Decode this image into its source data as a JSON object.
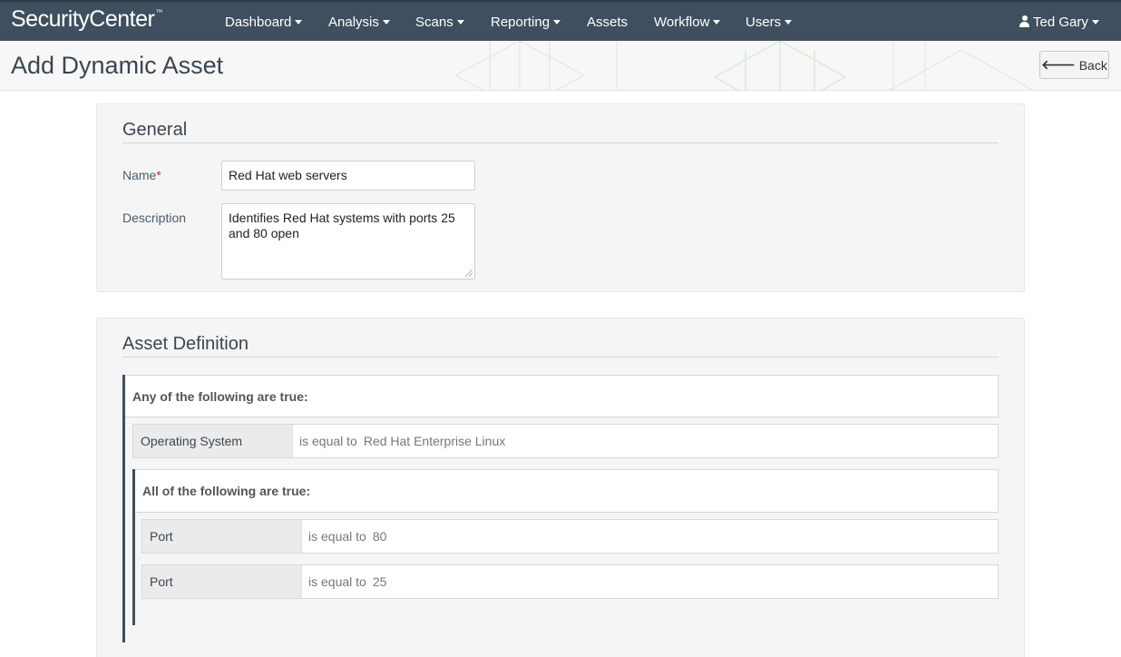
{
  "app": {
    "brand": "SecurityCenter",
    "brand_mark": "™"
  },
  "nav": {
    "items": [
      {
        "label": "Dashboard",
        "has_menu": true
      },
      {
        "label": "Analysis",
        "has_menu": true
      },
      {
        "label": "Scans",
        "has_menu": true
      },
      {
        "label": "Reporting",
        "has_menu": true
      },
      {
        "label": "Assets",
        "has_menu": false
      },
      {
        "label": "Workflow",
        "has_menu": true
      },
      {
        "label": "Users",
        "has_menu": true
      }
    ],
    "user": {
      "label": "Ted Gary",
      "icon": "user-icon"
    }
  },
  "header": {
    "title": "Add Dynamic Asset",
    "back_label": "Back",
    "back_icon": "arrow-left-icon"
  },
  "general": {
    "title": "General",
    "name_label": "Name",
    "required_mark": "*",
    "name_value": "Red Hat web servers",
    "description_label": "Description",
    "description_value": "Identifies Red Hat systems with ports 25 and 80 open"
  },
  "definition": {
    "title": "Asset Definition",
    "outer_group": {
      "label": "Any of the following are true:",
      "rules": [
        {
          "field": "Operating System",
          "operator": "is equal to",
          "value": "Red Hat Enterprise Linux"
        }
      ],
      "inner_group": {
        "label": "All of the following are true:",
        "rules": [
          {
            "field": "Port",
            "operator": "is equal to",
            "value": "80"
          },
          {
            "field": "Port",
            "operator": "is equal to",
            "value": "25"
          }
        ]
      }
    }
  },
  "colors": {
    "nav_bg": "#3f4f5f",
    "accent_border": "#3f4f5f",
    "required": "#c0392b"
  }
}
